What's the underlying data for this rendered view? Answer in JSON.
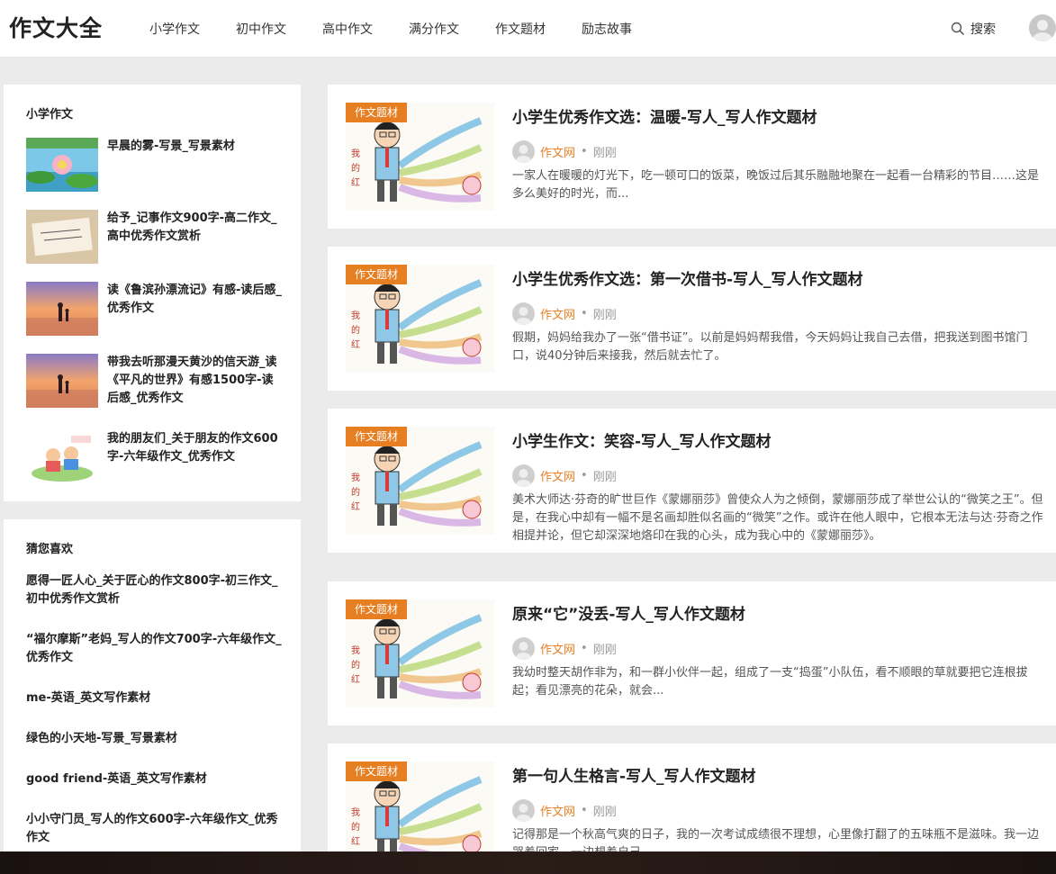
{
  "site": {
    "logo": "作文大全"
  },
  "nav": {
    "items": [
      {
        "label": "小学作文"
      },
      {
        "label": "初中作文"
      },
      {
        "label": "高中作文"
      },
      {
        "label": "满分作文"
      },
      {
        "label": "作文题材"
      },
      {
        "label": "励志故事"
      }
    ],
    "search_label": "搜索"
  },
  "sidebar": {
    "title": "小学作文",
    "items": [
      {
        "title": "早晨的雾-写景_写景素材"
      },
      {
        "title": "给予_记事作文900字-高二作文_高中优秀作文赏析"
      },
      {
        "title": "读《鲁滨孙漂流记》有感-读后感_优秀作文"
      },
      {
        "title": "带我去听那漫天黄沙的信天游_读《平凡的世界》有感1500字-读后感_优秀作文"
      },
      {
        "title": "我的朋友们_关于朋友的作文600字-六年级作文_优秀作文"
      }
    ]
  },
  "likes": {
    "title": "猜您喜欢",
    "items": [
      {
        "title": "愿得一匠人心_关于匠心的作文800字-初三作文_初中优秀作文赏析"
      },
      {
        "title": "“福尔摩斯”老妈_写人的作文700字-六年级作文_优秀作文"
      },
      {
        "title": "me-英语_英文写作素材"
      },
      {
        "title": "绿色的小天地-写景_写景素材"
      },
      {
        "title": "good friend-英语_英文写作素材"
      },
      {
        "title": "小小守门员_写人的作文600字-六年级作文_优秀作文"
      }
    ]
  },
  "articles": [
    {
      "tag": "作文题材",
      "title": "小学生优秀作文选：温暖-写人_写人作文题材",
      "author": "作文网",
      "time": "刚刚",
      "excerpt": "  一家人在暖暖的灯光下，吃一顿可口的饭菜，晚饭过后其乐融融地聚在一起看一台精彩的节目……这是多么美好的时光，而..."
    },
    {
      "tag": "作文题材",
      "title": "小学生优秀作文选：第一次借书-写人_写人作文题材",
      "author": "作文网",
      "time": "刚刚",
      "excerpt": "假期，妈妈给我办了一张“借书证”。以前是妈妈帮我借，今天妈妈让我自己去借，把我送到图书馆门口，说40分钟后来接我，然后就去忙了。"
    },
    {
      "tag": "作文题材",
      "title": "小学生作文：笑容-写人_写人作文题材",
      "author": "作文网",
      "time": "刚刚",
      "excerpt": "美术大师达·芬奇的旷世巨作《蒙娜丽莎》曾使众人为之倾倒，蒙娜丽莎成了举世公认的“微笑之王”。但是，在我心中却有一幅不是名画却胜似名画的“微笑”之作。或许在他人眼中，它根本无法与达·芬奇之作相提并论，但它却深深地烙印在我的心头，成为我心中的《蒙娜丽莎》。"
    },
    {
      "tag": "作文题材",
      "title": "原来“它”没丢-写人_写人作文题材",
      "author": "作文网",
      "time": "刚刚",
      "excerpt": "    我幼时整天胡作非为，和一群小伙伴一起，组成了一支“捣蛋”小队伍，看不顺眼的草就要把它连根拔起；看见漂亮的花朵，就会..."
    },
    {
      "tag": "作文题材",
      "title": "第一句人生格言-写人_写人作文题材",
      "author": "作文网",
      "time": "刚刚",
      "excerpt": "记得那是一个秋高气爽的日子，我的一次考试成绩很不理想，心里像打翻了的五味瓶不是滋味。我一边哭着回家，一边想着自己..."
    }
  ]
}
